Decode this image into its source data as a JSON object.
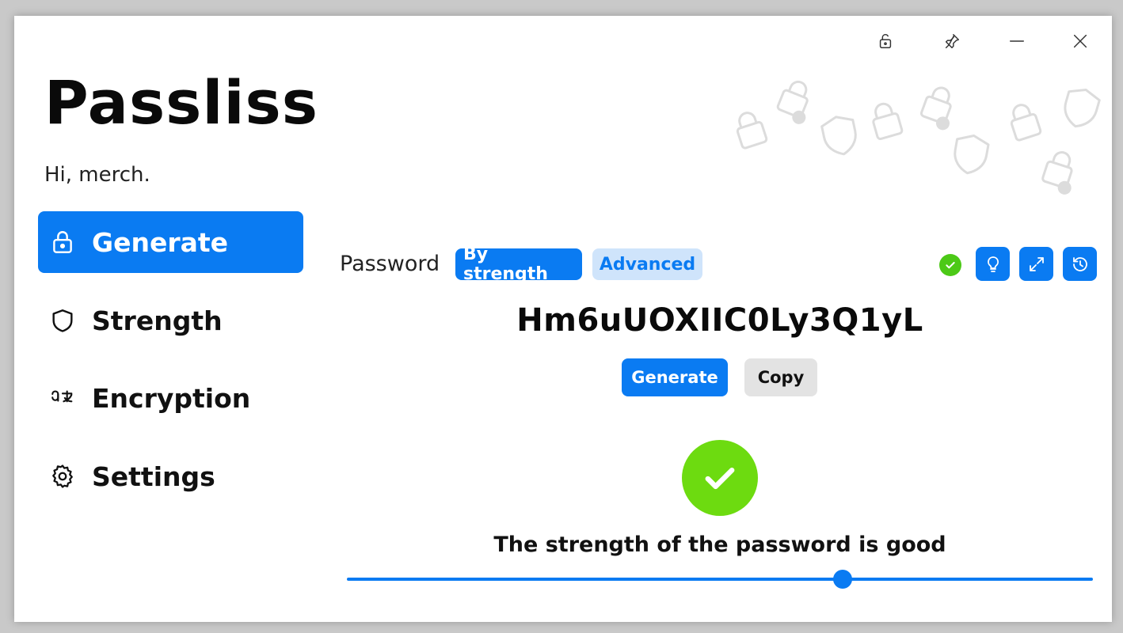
{
  "app": {
    "title": "Passliss",
    "greeting": "Hi, merch."
  },
  "titlebar": {
    "icons": [
      "unlock-icon",
      "pin-icon",
      "minimize-icon",
      "close-icon"
    ]
  },
  "sidebar": {
    "items": [
      {
        "label": "Generate",
        "icon": "lock-icon",
        "active": true
      },
      {
        "label": "Strength",
        "icon": "shield-icon",
        "active": false
      },
      {
        "label": "Encryption",
        "icon": "translate-icon",
        "active": false
      },
      {
        "label": "Settings",
        "icon": "gear-icon",
        "active": false
      }
    ]
  },
  "main": {
    "password_label": "Password",
    "modes": [
      {
        "label": "By strength",
        "selected": true
      },
      {
        "label": "Advanced",
        "selected": false
      }
    ],
    "tools": [
      "lightbulb-icon",
      "expand-icon",
      "history-icon"
    ],
    "password": "Hm6uUOXIIC0Ly3Q1yL",
    "buttons": {
      "generate": "Generate",
      "copy": "Copy"
    },
    "strength_text": "The strength of the password is good",
    "slider_level": 0.665
  },
  "colors": {
    "accent": "#0a7bf2",
    "accent_light": "#cfe4fb",
    "success": "#6ddb10",
    "success_dot": "#4cc917",
    "decor": "#dcdcdc"
  }
}
